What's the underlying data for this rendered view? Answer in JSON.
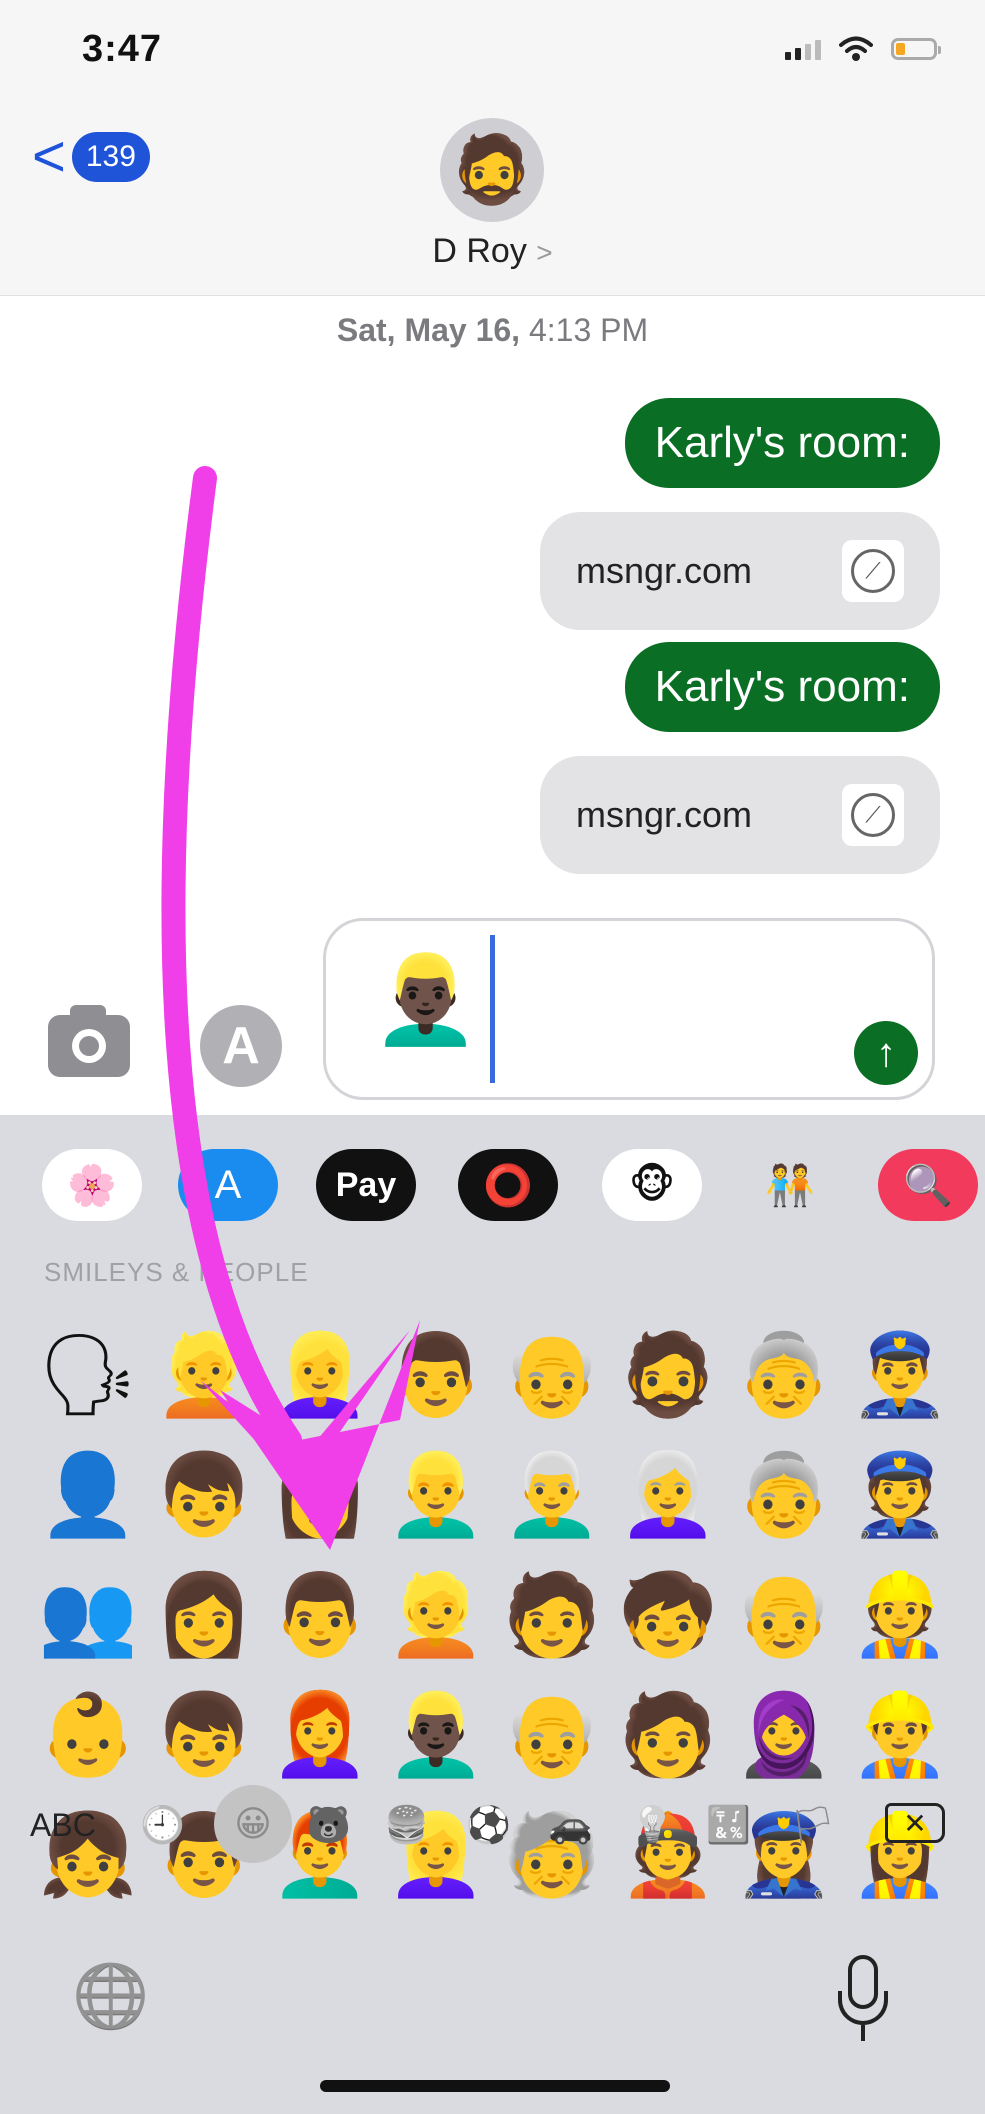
{
  "status_bar": {
    "time": "3:47"
  },
  "header": {
    "back_count": "139",
    "back_chevron": "<",
    "contact_name": "D Roy",
    "contact_chevron": ">"
  },
  "timestamp": {
    "date": "Sat, May 16,",
    "time": "4:13 PM"
  },
  "messages": [
    {
      "type": "text",
      "text": "Karly's room:"
    },
    {
      "type": "link",
      "text": "msngr.com"
    },
    {
      "type": "text",
      "text": "Karly's room:"
    },
    {
      "type": "link",
      "text": "msngr.com"
    }
  ],
  "composer": {
    "emoji": "👱🏿‍♂️",
    "send_icon": "↑",
    "appstore_icon": "A"
  },
  "app_drawer": {
    "apple_pay_label": "Pay",
    "icons": [
      "photos-icon",
      "appstore-icon",
      "apple-pay-icon",
      "activity-icon",
      "monkey-sticker-icon",
      "memoji-icon",
      "search-images-icon"
    ]
  },
  "keyboard": {
    "section_label": "SMILEYS & PEOPLE",
    "emoji_rows": [
      [
        "🗣",
        "👱",
        "👱‍♀️",
        "👨",
        "👴",
        "🧔",
        "👵",
        "👮‍♂️"
      ],
      [
        "👤",
        "👦",
        "👩",
        "👱‍♂️",
        "👨‍🦳",
        "👩‍🦳",
        "👵",
        "👮"
      ],
      [
        "👥",
        "👩",
        "👨",
        "👱",
        "🧑",
        "🧒",
        "👴",
        "👷"
      ],
      [
        "👶",
        "👦",
        "👩‍🦰",
        "👱🏿‍♂️",
        "👴",
        "🧑",
        "🧕",
        "👷‍♂️"
      ],
      [
        "👧",
        "👨",
        "👨‍🦰",
        "👱‍♀️",
        "🧓",
        "👲",
        "👮‍♀️",
        "👷‍♀️"
      ]
    ],
    "abc_label": "ABC",
    "category_icons": [
      "🕘",
      "😀",
      "🐻",
      "🍔",
      "⚽",
      "🚗",
      "💡",
      "🔣",
      "🏳"
    ],
    "delete_icon": "✕",
    "globe_icon": "🌐"
  },
  "colors": {
    "imessage_green": "#0a6e24",
    "link_bubble": "#e3e3e6",
    "annotation_arrow": "#f03ee8",
    "back_blue": "#1f54d8"
  }
}
